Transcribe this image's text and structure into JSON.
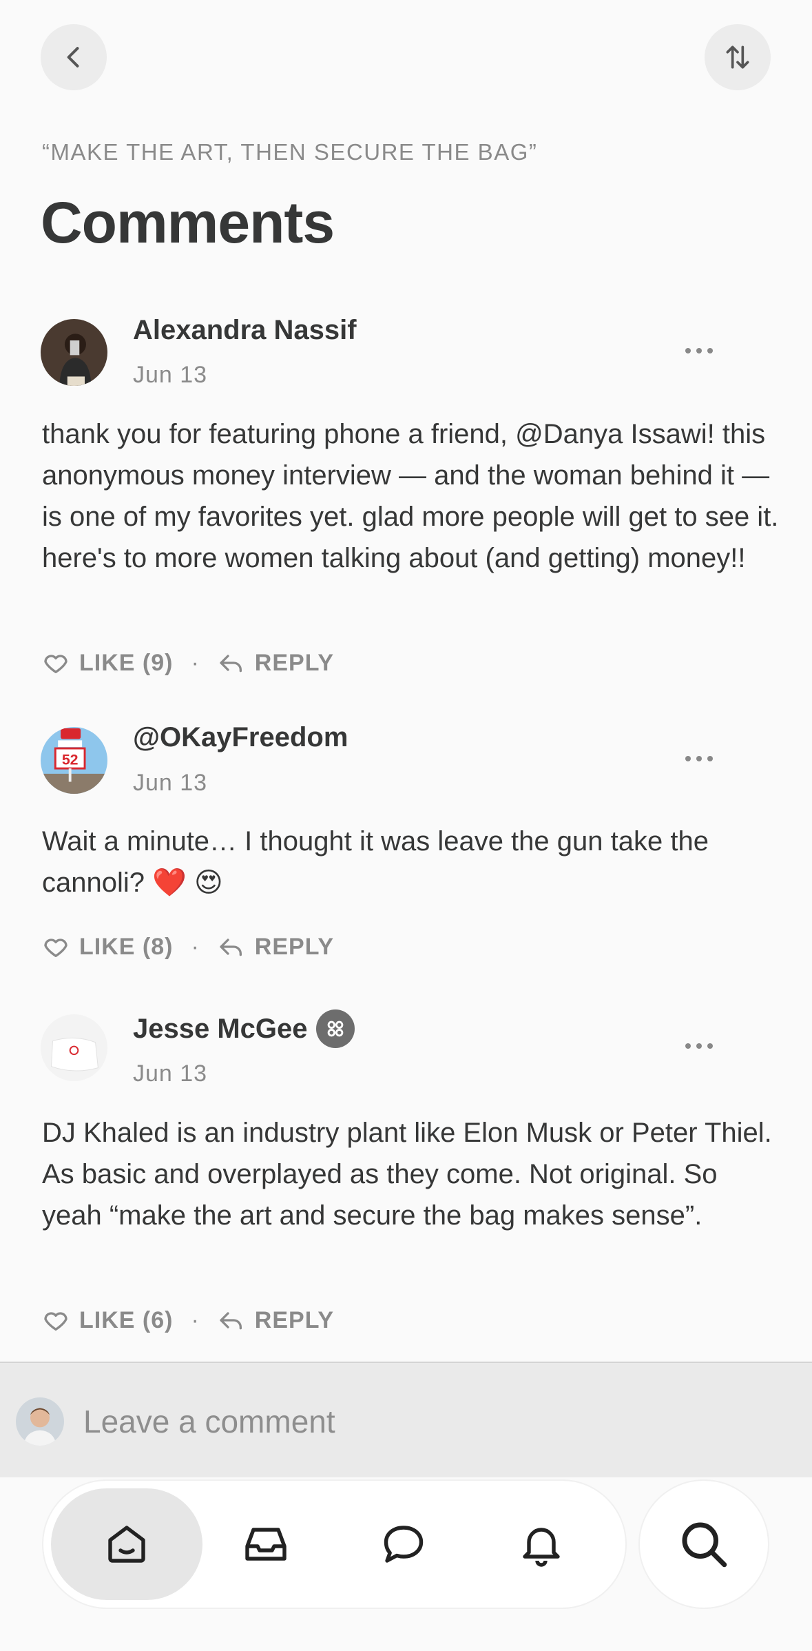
{
  "header": {
    "back_icon": "chevron-left-icon",
    "sort_icon": "sort-arrows-icon",
    "post_title": "“MAKE THE ART, THEN SECURE THE BAG”",
    "page_title": "Comments"
  },
  "comments": [
    {
      "author": "Alexandra Nassif",
      "date": "Jun  13",
      "text": "thank you for featuring phone a friend, @Danya Issawi! this anonymous money interview — and the woman behind it — is one of my favorites yet. glad more people will get to see it. here's to more women talking about (and getting) money!!",
      "like_label": "LIKE (9)",
      "reply_label": "REPLY"
    },
    {
      "author": "@OKayFreedom",
      "date": "Jun  13",
      "text": "Wait a minute… I thought it was leave the gun take the cannoli? ❤️  😍",
      "like_label": "LIKE (8)",
      "reply_label": "REPLY"
    },
    {
      "author": "Jesse McGee",
      "date": "Jun  13",
      "text": "DJ Khaled is an industry plant like Elon Musk or Peter Thiel. As basic and overplayed as they come. Not original. So yeah “make the art and secure the bag makes sense”.",
      "like_label": "LIKE (6)",
      "reply_label": "REPLY"
    }
  ],
  "separator": "·",
  "composer": {
    "placeholder": "Leave a comment"
  },
  "tabbar": {
    "tabs": [
      "home-icon",
      "inbox-icon",
      "chat-icon",
      "bell-icon"
    ],
    "active": "home-icon",
    "search": "search-icon"
  }
}
